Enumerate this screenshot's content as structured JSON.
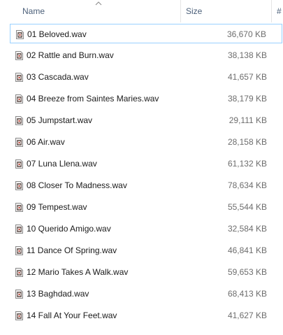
{
  "columns": {
    "name": "Name",
    "size": "Size",
    "extra": "#"
  },
  "icons": {
    "sort": "sort-ascending-icon",
    "file": "wav-audio-file-icon"
  },
  "colors": {
    "header_text": "#4c607a",
    "focus_border": "#99d1ff",
    "size_text": "#6d6d6d"
  },
  "files": [
    {
      "name": "01 Beloved.wav",
      "size": "36,670 KB"
    },
    {
      "name": "02 Rattle and Burn.wav",
      "size": "38,138 KB"
    },
    {
      "name": "03 Cascada.wav",
      "size": "41,657 KB"
    },
    {
      "name": "04 Breeze from Saintes Maries.wav",
      "size": "38,179 KB"
    },
    {
      "name": "05 Jumpstart.wav",
      "size": "29,111 KB"
    },
    {
      "name": "06 Air.wav",
      "size": "28,158 KB"
    },
    {
      "name": "07 Luna Llena.wav",
      "size": "61,132 KB"
    },
    {
      "name": "08 Closer To Madness.wav",
      "size": "78,634 KB"
    },
    {
      "name": "09 Tempest.wav",
      "size": "55,544 KB"
    },
    {
      "name": "10 Querido Amigo.wav",
      "size": "32,584 KB"
    },
    {
      "name": "11 Dance Of Spring.wav",
      "size": "46,841 KB"
    },
    {
      "name": "12 Mario Takes A Walk.wav",
      "size": "59,653 KB"
    },
    {
      "name": "13 Baghdad.wav",
      "size": "68,413 KB"
    },
    {
      "name": "14 Fall At Your Feet.wav",
      "size": "41,627 KB"
    }
  ]
}
